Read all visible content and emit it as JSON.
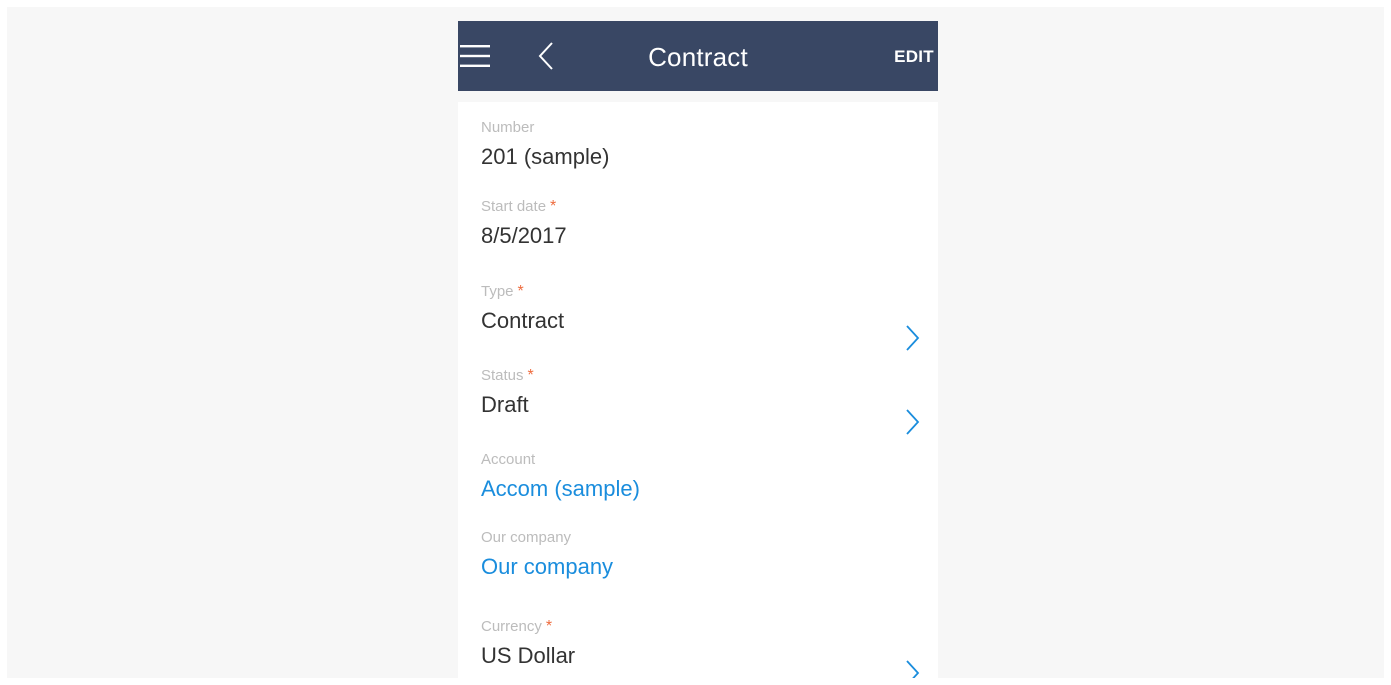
{
  "header": {
    "title": "Contract",
    "edit_label": "EDIT",
    "menu_icon": "hamburger-menu-icon",
    "back_icon": "chevron-left-icon",
    "background_color": "#394764"
  },
  "fields": {
    "number": {
      "label": "Number",
      "value": "201 (sample)"
    },
    "start_date": {
      "label": "Start date",
      "required_mark": "*",
      "value": "8/5/2017"
    },
    "type": {
      "label": "Type",
      "required_mark": "*",
      "value": "Contract"
    },
    "status": {
      "label": "Status",
      "required_mark": "*",
      "value": "Draft"
    },
    "account": {
      "label": "Account",
      "value": "Accom (sample)"
    },
    "our_company": {
      "label": "Our company",
      "value": "Our company"
    },
    "currency": {
      "label": "Currency",
      "required_mark": "*",
      "value": "US Dollar"
    }
  },
  "colors": {
    "label": "#bcbcbc",
    "required": "#ee6b3d",
    "link": "#1a8ddd",
    "chevron": "#1a8ddd",
    "value": "#333333"
  }
}
